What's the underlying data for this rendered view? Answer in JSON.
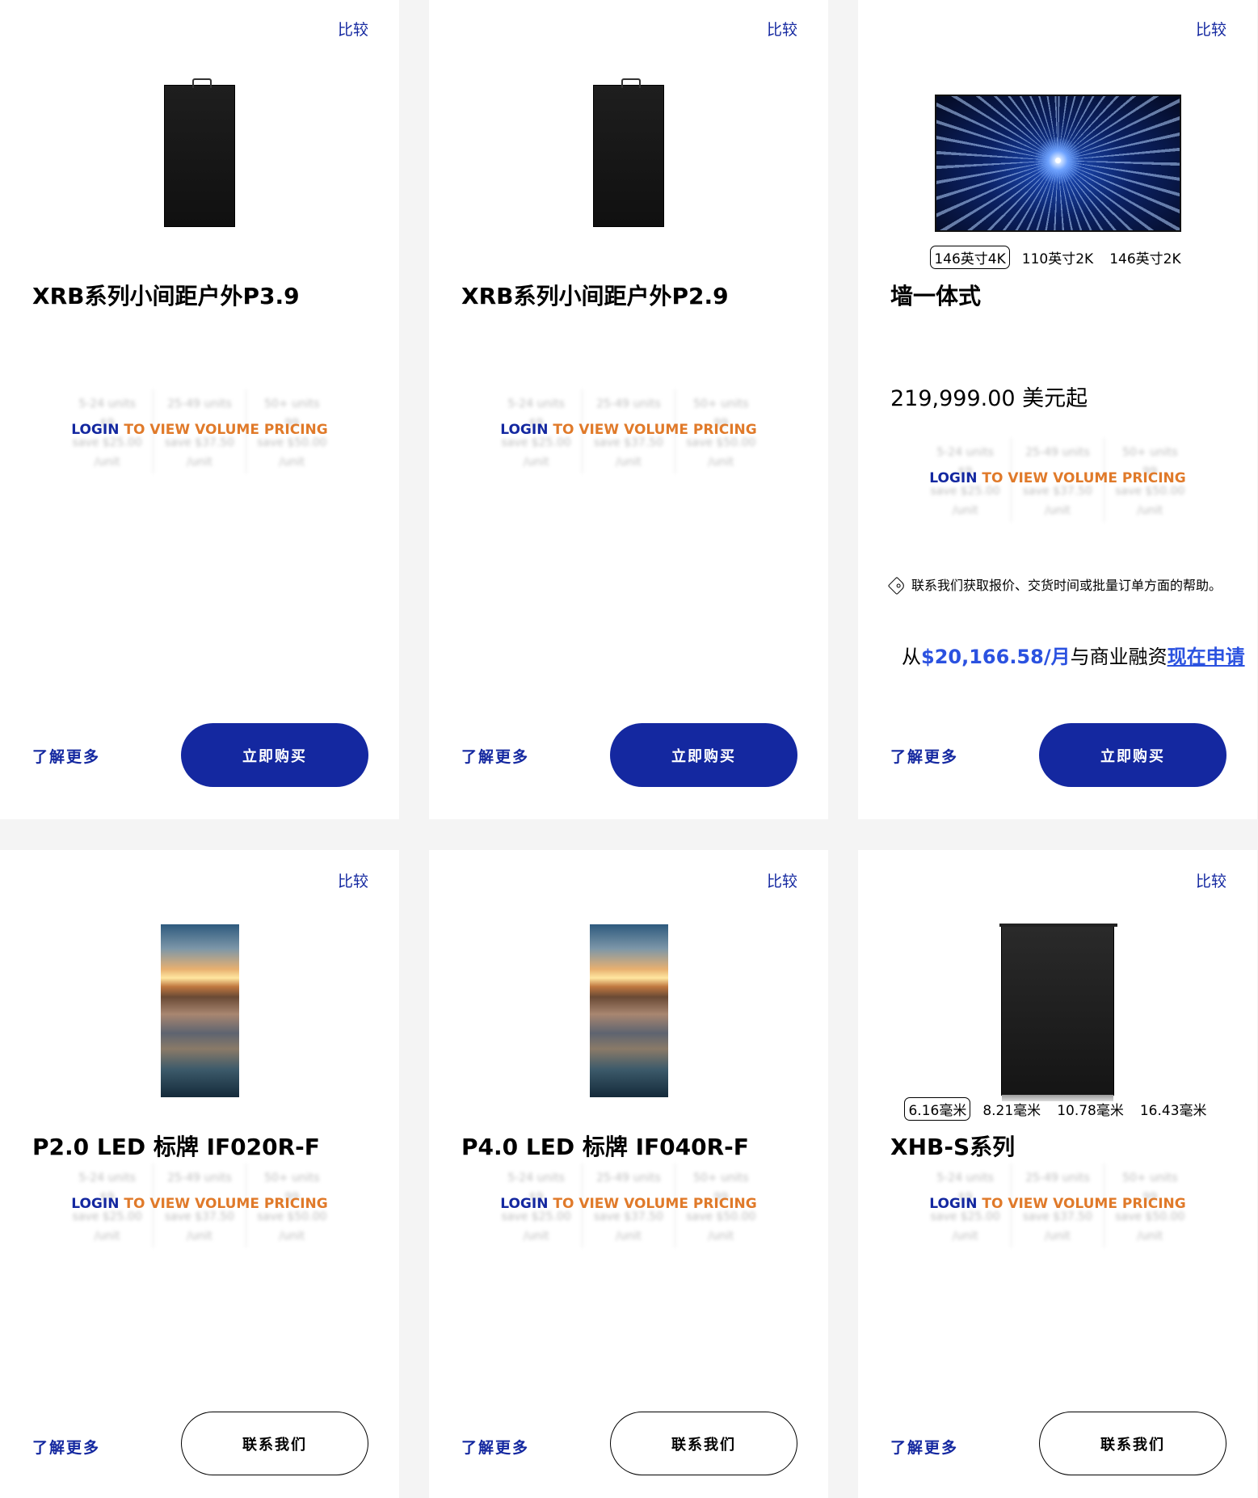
{
  "common": {
    "compare": "比较",
    "learn_more": "了解更多",
    "buy_now": "立即购买",
    "contact_us": "联系我们",
    "volume": {
      "tiers": [
        "5-24 units",
        "25-49 units",
        "50+ units"
      ],
      "price_prefix": "$9",
      "price_suffix": "99",
      "saves": [
        "save $25.00",
        "save $37.50",
        "save $50.00"
      ],
      "per_unit": "/unit",
      "login_part1": "LOGIN",
      "login_part2": " TO VIEW VOLUME PRICING"
    }
  },
  "products": [
    {
      "title": "XRB系列小间距户外P3.9",
      "image": "led-cabinet",
      "cta": "buy"
    },
    {
      "title": "XRB系列小间距户外P2.9",
      "image": "led-cabinet",
      "cta": "buy"
    },
    {
      "title": "墙一体式",
      "image": "led-wall-tunnel",
      "variants": [
        "146英寸4K",
        "110英寸2K",
        "146英寸2K"
      ],
      "selected_variant": "146英寸4K",
      "price": "219,999.00 美元起",
      "contact_note": "联系我们获取报价、交货时间或批量订单方面的帮助。",
      "finance_prefix": "从",
      "finance_amount": "$20,166.58/月",
      "finance_middle": "与商业融资",
      "finance_apply": "现在申请",
      "cta": "buy"
    },
    {
      "title": "P2.0 LED 标牌 IF020R-F",
      "image": "sunset-signage",
      "cta": "contact"
    },
    {
      "title": "P4.0 LED 标牌 IF040R-F",
      "image": "sunset-signage",
      "cta": "contact"
    },
    {
      "title": "XHB-S系列",
      "image": "led-cabinet-wide",
      "variants": [
        "6.16毫米",
        "8.21毫米",
        "10.78毫米",
        "16.43毫米"
      ],
      "selected_variant": "6.16毫米",
      "cta": "contact"
    }
  ]
}
